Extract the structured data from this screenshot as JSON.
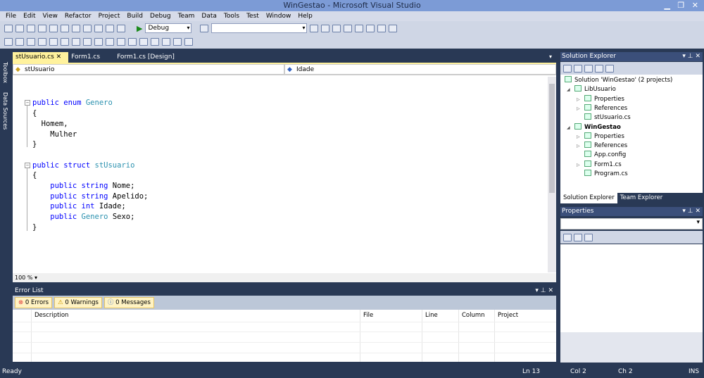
{
  "window": {
    "title": "WinGestao - Microsoft Visual Studio"
  },
  "menu": [
    "File",
    "Edit",
    "View",
    "Refactor",
    "Project",
    "Build",
    "Debug",
    "Team",
    "Data",
    "Tools",
    "Test",
    "Window",
    "Help"
  ],
  "toolbar": {
    "config": "Debug",
    "platform": ""
  },
  "side_tabs": [
    "Toolbox",
    "Data Sources"
  ],
  "tabs": [
    {
      "label": "stUsuario.cs ✕"
    },
    {
      "label": "Form1.cs"
    },
    {
      "label": "Form1.cs [Design]"
    }
  ],
  "nav": {
    "type": "stUsuario",
    "member": "Idade"
  },
  "code": {
    "lines": [
      [],
      [],
      [
        [
          "kw",
          "public enum "
        ],
        [
          "ty",
          "Genero"
        ]
      ],
      [
        [
          "",
          "{"
        ]
      ],
      [
        [
          "",
          "  Homem,"
        ]
      ],
      [
        [
          "",
          "    Mulher"
        ]
      ],
      [
        [
          "",
          "}"
        ]
      ],
      [],
      [
        [
          "kw",
          "public struct "
        ],
        [
          "ty",
          "stUsuario"
        ]
      ],
      [
        [
          "",
          "{"
        ]
      ],
      [
        [
          "kw",
          "    public string "
        ],
        [
          "",
          "Nome;"
        ]
      ],
      [
        [
          "kw",
          "    public string "
        ],
        [
          "",
          "Apelido;"
        ]
      ],
      [
        [
          "kw",
          "    public int "
        ],
        [
          "",
          "Idade;"
        ]
      ],
      [
        [
          "kw",
          "    public "
        ],
        [
          "ty",
          "Genero "
        ],
        [
          "",
          "Sexo;"
        ]
      ],
      [
        [
          "",
          "}"
        ]
      ]
    ]
  },
  "zoom": "100 %",
  "error_list": {
    "title": "Error List",
    "errors": "0 Errors",
    "warnings": "0 Warnings",
    "messages": "0 Messages",
    "columns": [
      "Description",
      "File",
      "Line",
      "Column",
      "Project"
    ]
  },
  "solution_explorer": {
    "title": "Solution Explorer",
    "items": [
      {
        "label": "Solution 'WinGestao' (2 projects)",
        "level": 0
      },
      {
        "label": "LibUsuario",
        "level": 1,
        "expand": "◢"
      },
      {
        "label": "Properties",
        "level": 2,
        "expand": "▷"
      },
      {
        "label": "References",
        "level": 2,
        "expand": "▷"
      },
      {
        "label": "stUsuario.cs",
        "level": 2
      },
      {
        "label": "WinGestao",
        "level": 1,
        "expand": "◢",
        "bold": true
      },
      {
        "label": "Properties",
        "level": 2,
        "expand": "▷"
      },
      {
        "label": "References",
        "level": 2,
        "expand": "▷"
      },
      {
        "label": "App.config",
        "level": 2
      },
      {
        "label": "Form1.cs",
        "level": 2,
        "expand": "▷"
      },
      {
        "label": "Program.cs",
        "level": 2
      }
    ],
    "tabs": [
      "Solution Explorer",
      "Team Explorer"
    ]
  },
  "properties": {
    "title": "Properties"
  },
  "status": {
    "text": "Ready",
    "ln": "Ln 13",
    "col": "Col 2",
    "ch": "Ch 2",
    "mode": "INS"
  }
}
